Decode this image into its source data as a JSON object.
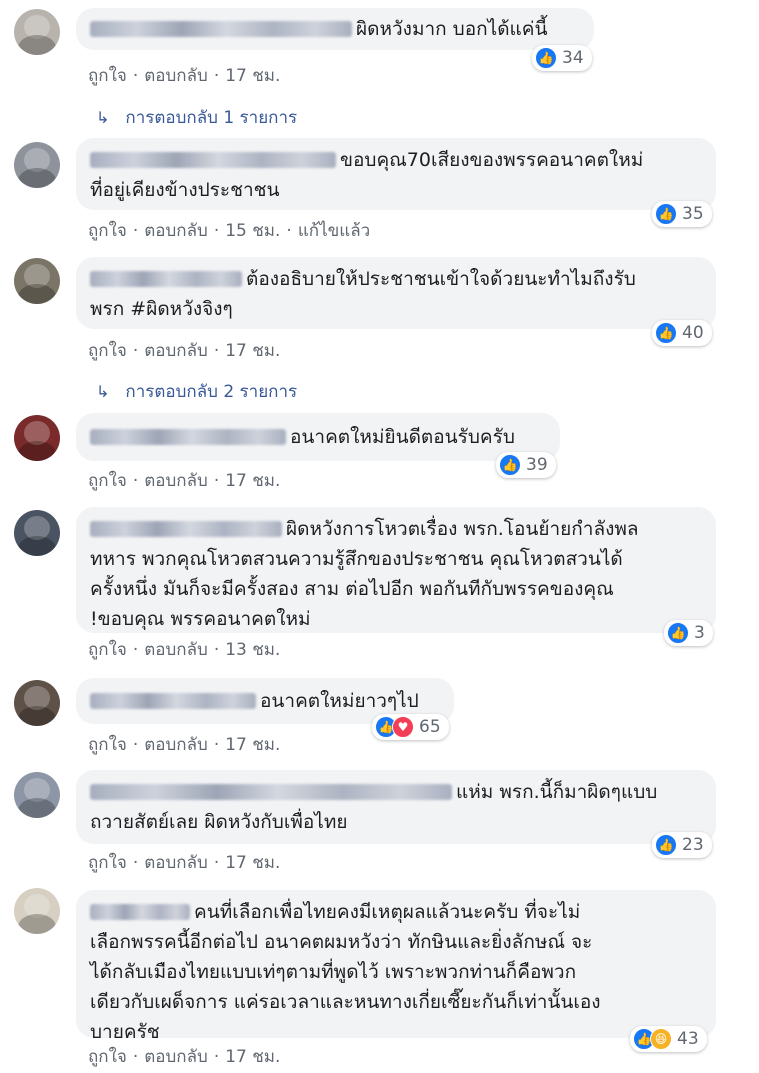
{
  "actions": {
    "like": "ถูกใจ",
    "reply": "ตอบกลับ",
    "edited": "แก้ไขแล้ว",
    "dot": "·"
  },
  "comments": [
    {
      "text": "ผิดหวังมาก บอกได้แค่นี้",
      "reactions": "34",
      "time": "17 ชม.",
      "replies": "การตอบกลับ 1 รายการ"
    },
    {
      "text": "ขอบคุณ70เสียงของพรรคอนาคตใหม่\nที่อยู่เคียงข้างประชาชน",
      "reactions": "35",
      "time": "15 ชม."
    },
    {
      "text": "ต้องอธิบายให้ประชาชนเข้าใจด้วยนะทำไมถึงรับ\nพรก #ผิดหวังจิงๆ",
      "reactions": "40",
      "time": "17 ชม.",
      "replies": "การตอบกลับ 2 รายการ"
    },
    {
      "text": "อนาคตใหม่ยินดีตอนรับครับ",
      "reactions": "39",
      "time": "17 ชม."
    },
    {
      "text": "ผิดหวังการโหวตเรื่อง พรก.โอนย้ายกำลังพล\nทหาร พวกคุณโหวตสวนความรู้สึกของประชาชน คุณโหวตสวนได้\nครั้งหนึ่ง มันก็จะมีครั้งสอง สาม ต่อไปอีก พอกันทีกับพรรคของคุณ\n!ขอบคุณ พรรคอนาคตใหม่",
      "reactions": "3",
      "time": "13 ชม."
    },
    {
      "text": "อนาคตใหม่ยาวๆไป",
      "reactions": "65",
      "time": "17 ชม."
    },
    {
      "text": "แห่ม พรก.นี้ก็มาผิดๆแบบ\nถวายสัตย์เลย ผิดหวังกับเพื่อไทย",
      "reactions": "23",
      "time": "17 ชม."
    },
    {
      "text": "คนที่เลือกเพื่อไทยคงมีเหตุผลแล้วนะครับ ที่จะไม่\nเลือกพรรคนี้อีกต่อไป อนาคตผมหวังว่า ทักษินและยิ่งลักษณ์ จะ\nได้กลับเมืองไทยแบบเท่ๆตามที่พูดไว้ เพราะพวกท่านก็คือพวก\nเดียวกับเผด็จการ แค่รอเวลาและหนทางเกี่ยเซี๊ยะกันก็เท่านั้นเอง\nบายครัช",
      "reactions": "43",
      "time": "17 ชม."
    }
  ],
  "colors": {
    "bubble": "#f2f3f5",
    "meta": "#606770",
    "link": "#385898",
    "like": "#1877f2",
    "love": "#f33e58",
    "haha": "#f7b125"
  },
  "icons": {
    "like": "like-icon",
    "love": "love-icon",
    "haha": "haha-icon",
    "reply_arrow": "reply-arrow-icon"
  }
}
